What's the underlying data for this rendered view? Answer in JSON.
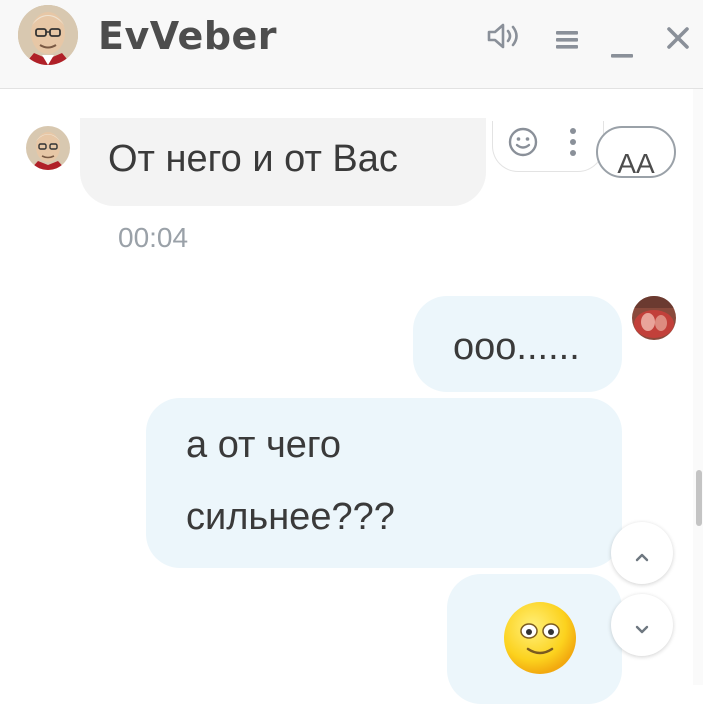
{
  "header": {
    "contact_name": "EvVeber",
    "buttons": {
      "sound": "speaker-icon",
      "menu": "hamburger-menu-icon",
      "minimize": "minimize-icon",
      "close": "close-icon"
    }
  },
  "messages": [
    {
      "direction": "incoming",
      "text": "От него и от Вас",
      "time": "00:04"
    },
    {
      "direction": "outgoing",
      "text": "ооо......"
    },
    {
      "direction": "outgoing",
      "lines": [
        "а от чего",
        "сильнее???"
      ]
    },
    {
      "direction": "outgoing",
      "emoji": "smiling-face-emoji"
    }
  ],
  "message_actions": {
    "emoji_icon": "smiley-icon",
    "more_icon": "more-vertical-icon",
    "font_size_label": "AA"
  },
  "scroll_buttons": {
    "up": "chevron-up-icon",
    "down": "chevron-down-icon"
  },
  "colors": {
    "header_bg": "#f8f8f8",
    "incoming_bubble": "#f3f3f3",
    "outgoing_bubble": "#ecf6fb",
    "text": "#3a3a3a",
    "timestamp": "#9aa1a8",
    "emoji_yellow": "#fcd21e"
  }
}
